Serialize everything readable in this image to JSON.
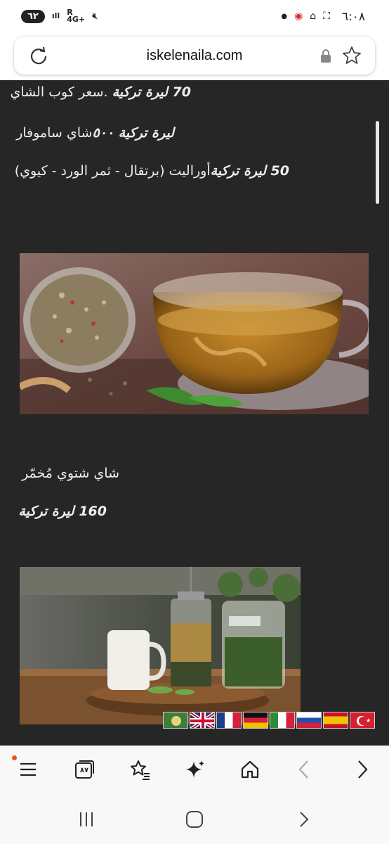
{
  "status_bar": {
    "time": "٦:٠٨",
    "battery": "٦٢",
    "network_r": "R",
    "network_4g": "4G+"
  },
  "browser": {
    "url": "iskelenaila.com"
  },
  "menu": {
    "line1_price": "70 ليرة تركية",
    "line1_text": ".سعر كوب الشاي",
    "line2_price": "ليرة تركية ٥٠٠",
    "line2_text": "شاي ساموفار",
    "line3_price": "50 ليرة تركية",
    "line3_text": "أوراليت (برتقال - ثمر الورد - كيوي)",
    "item2_title": "شاي شتوي مُخمّر",
    "item2_price": "160 ليرة تركية"
  },
  "icons": {
    "reload": "reload-icon",
    "lock": "lock-icon",
    "bookmark": "star-icon",
    "menu": "hamburger-menu-icon",
    "tabs": "tabs-icon",
    "bookmarks": "bookmarks-icon",
    "ai": "sparkle-icon",
    "home": "home-icon",
    "back": "back-icon",
    "forward": "forward-icon"
  },
  "toolbar": {
    "tabs_count": "٨٧"
  },
  "languages": [
    "ar",
    "en",
    "fr",
    "de",
    "it",
    "ru",
    "es",
    "tr"
  ],
  "colors": {
    "background": "#262626",
    "text": "#eeeeee",
    "badge": "#e8590c"
  }
}
